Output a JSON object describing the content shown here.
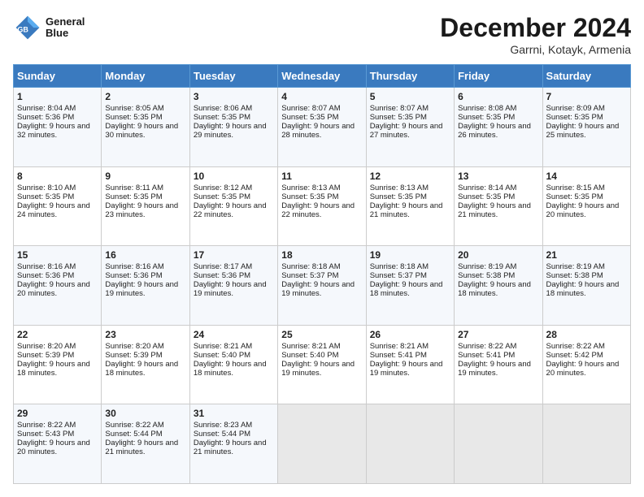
{
  "header": {
    "logo_line1": "General",
    "logo_line2": "Blue",
    "month": "December 2024",
    "location": "Garrni, Kotayk, Armenia"
  },
  "days_of_week": [
    "Sunday",
    "Monday",
    "Tuesday",
    "Wednesday",
    "Thursday",
    "Friday",
    "Saturday"
  ],
  "weeks": [
    [
      {
        "day": "1",
        "sunrise": "Sunrise: 8:04 AM",
        "sunset": "Sunset: 5:36 PM",
        "daylight": "Daylight: 9 hours and 32 minutes."
      },
      {
        "day": "2",
        "sunrise": "Sunrise: 8:05 AM",
        "sunset": "Sunset: 5:35 PM",
        "daylight": "Daylight: 9 hours and 30 minutes."
      },
      {
        "day": "3",
        "sunrise": "Sunrise: 8:06 AM",
        "sunset": "Sunset: 5:35 PM",
        "daylight": "Daylight: 9 hours and 29 minutes."
      },
      {
        "day": "4",
        "sunrise": "Sunrise: 8:07 AM",
        "sunset": "Sunset: 5:35 PM",
        "daylight": "Daylight: 9 hours and 28 minutes."
      },
      {
        "day": "5",
        "sunrise": "Sunrise: 8:07 AM",
        "sunset": "Sunset: 5:35 PM",
        "daylight": "Daylight: 9 hours and 27 minutes."
      },
      {
        "day": "6",
        "sunrise": "Sunrise: 8:08 AM",
        "sunset": "Sunset: 5:35 PM",
        "daylight": "Daylight: 9 hours and 26 minutes."
      },
      {
        "day": "7",
        "sunrise": "Sunrise: 8:09 AM",
        "sunset": "Sunset: 5:35 PM",
        "daylight": "Daylight: 9 hours and 25 minutes."
      }
    ],
    [
      {
        "day": "8",
        "sunrise": "Sunrise: 8:10 AM",
        "sunset": "Sunset: 5:35 PM",
        "daylight": "Daylight: 9 hours and 24 minutes."
      },
      {
        "day": "9",
        "sunrise": "Sunrise: 8:11 AM",
        "sunset": "Sunset: 5:35 PM",
        "daylight": "Daylight: 9 hours and 23 minutes."
      },
      {
        "day": "10",
        "sunrise": "Sunrise: 8:12 AM",
        "sunset": "Sunset: 5:35 PM",
        "daylight": "Daylight: 9 hours and 22 minutes."
      },
      {
        "day": "11",
        "sunrise": "Sunrise: 8:13 AM",
        "sunset": "Sunset: 5:35 PM",
        "daylight": "Daylight: 9 hours and 22 minutes."
      },
      {
        "day": "12",
        "sunrise": "Sunrise: 8:13 AM",
        "sunset": "Sunset: 5:35 PM",
        "daylight": "Daylight: 9 hours and 21 minutes."
      },
      {
        "day": "13",
        "sunrise": "Sunrise: 8:14 AM",
        "sunset": "Sunset: 5:35 PM",
        "daylight": "Daylight: 9 hours and 21 minutes."
      },
      {
        "day": "14",
        "sunrise": "Sunrise: 8:15 AM",
        "sunset": "Sunset: 5:35 PM",
        "daylight": "Daylight: 9 hours and 20 minutes."
      }
    ],
    [
      {
        "day": "15",
        "sunrise": "Sunrise: 8:16 AM",
        "sunset": "Sunset: 5:36 PM",
        "daylight": "Daylight: 9 hours and 20 minutes."
      },
      {
        "day": "16",
        "sunrise": "Sunrise: 8:16 AM",
        "sunset": "Sunset: 5:36 PM",
        "daylight": "Daylight: 9 hours and 19 minutes."
      },
      {
        "day": "17",
        "sunrise": "Sunrise: 8:17 AM",
        "sunset": "Sunset: 5:36 PM",
        "daylight": "Daylight: 9 hours and 19 minutes."
      },
      {
        "day": "18",
        "sunrise": "Sunrise: 8:18 AM",
        "sunset": "Sunset: 5:37 PM",
        "daylight": "Daylight: 9 hours and 19 minutes."
      },
      {
        "day": "19",
        "sunrise": "Sunrise: 8:18 AM",
        "sunset": "Sunset: 5:37 PM",
        "daylight": "Daylight: 9 hours and 18 minutes."
      },
      {
        "day": "20",
        "sunrise": "Sunrise: 8:19 AM",
        "sunset": "Sunset: 5:38 PM",
        "daylight": "Daylight: 9 hours and 18 minutes."
      },
      {
        "day": "21",
        "sunrise": "Sunrise: 8:19 AM",
        "sunset": "Sunset: 5:38 PM",
        "daylight": "Daylight: 9 hours and 18 minutes."
      }
    ],
    [
      {
        "day": "22",
        "sunrise": "Sunrise: 8:20 AM",
        "sunset": "Sunset: 5:39 PM",
        "daylight": "Daylight: 9 hours and 18 minutes."
      },
      {
        "day": "23",
        "sunrise": "Sunrise: 8:20 AM",
        "sunset": "Sunset: 5:39 PM",
        "daylight": "Daylight: 9 hours and 18 minutes."
      },
      {
        "day": "24",
        "sunrise": "Sunrise: 8:21 AM",
        "sunset": "Sunset: 5:40 PM",
        "daylight": "Daylight: 9 hours and 18 minutes."
      },
      {
        "day": "25",
        "sunrise": "Sunrise: 8:21 AM",
        "sunset": "Sunset: 5:40 PM",
        "daylight": "Daylight: 9 hours and 19 minutes."
      },
      {
        "day": "26",
        "sunrise": "Sunrise: 8:21 AM",
        "sunset": "Sunset: 5:41 PM",
        "daylight": "Daylight: 9 hours and 19 minutes."
      },
      {
        "day": "27",
        "sunrise": "Sunrise: 8:22 AM",
        "sunset": "Sunset: 5:41 PM",
        "daylight": "Daylight: 9 hours and 19 minutes."
      },
      {
        "day": "28",
        "sunrise": "Sunrise: 8:22 AM",
        "sunset": "Sunset: 5:42 PM",
        "daylight": "Daylight: 9 hours and 20 minutes."
      }
    ],
    [
      {
        "day": "29",
        "sunrise": "Sunrise: 8:22 AM",
        "sunset": "Sunset: 5:43 PM",
        "daylight": "Daylight: 9 hours and 20 minutes."
      },
      {
        "day": "30",
        "sunrise": "Sunrise: 8:22 AM",
        "sunset": "Sunset: 5:44 PM",
        "daylight": "Daylight: 9 hours and 21 minutes."
      },
      {
        "day": "31",
        "sunrise": "Sunrise: 8:23 AM",
        "sunset": "Sunset: 5:44 PM",
        "daylight": "Daylight: 9 hours and 21 minutes."
      },
      null,
      null,
      null,
      null
    ]
  ]
}
